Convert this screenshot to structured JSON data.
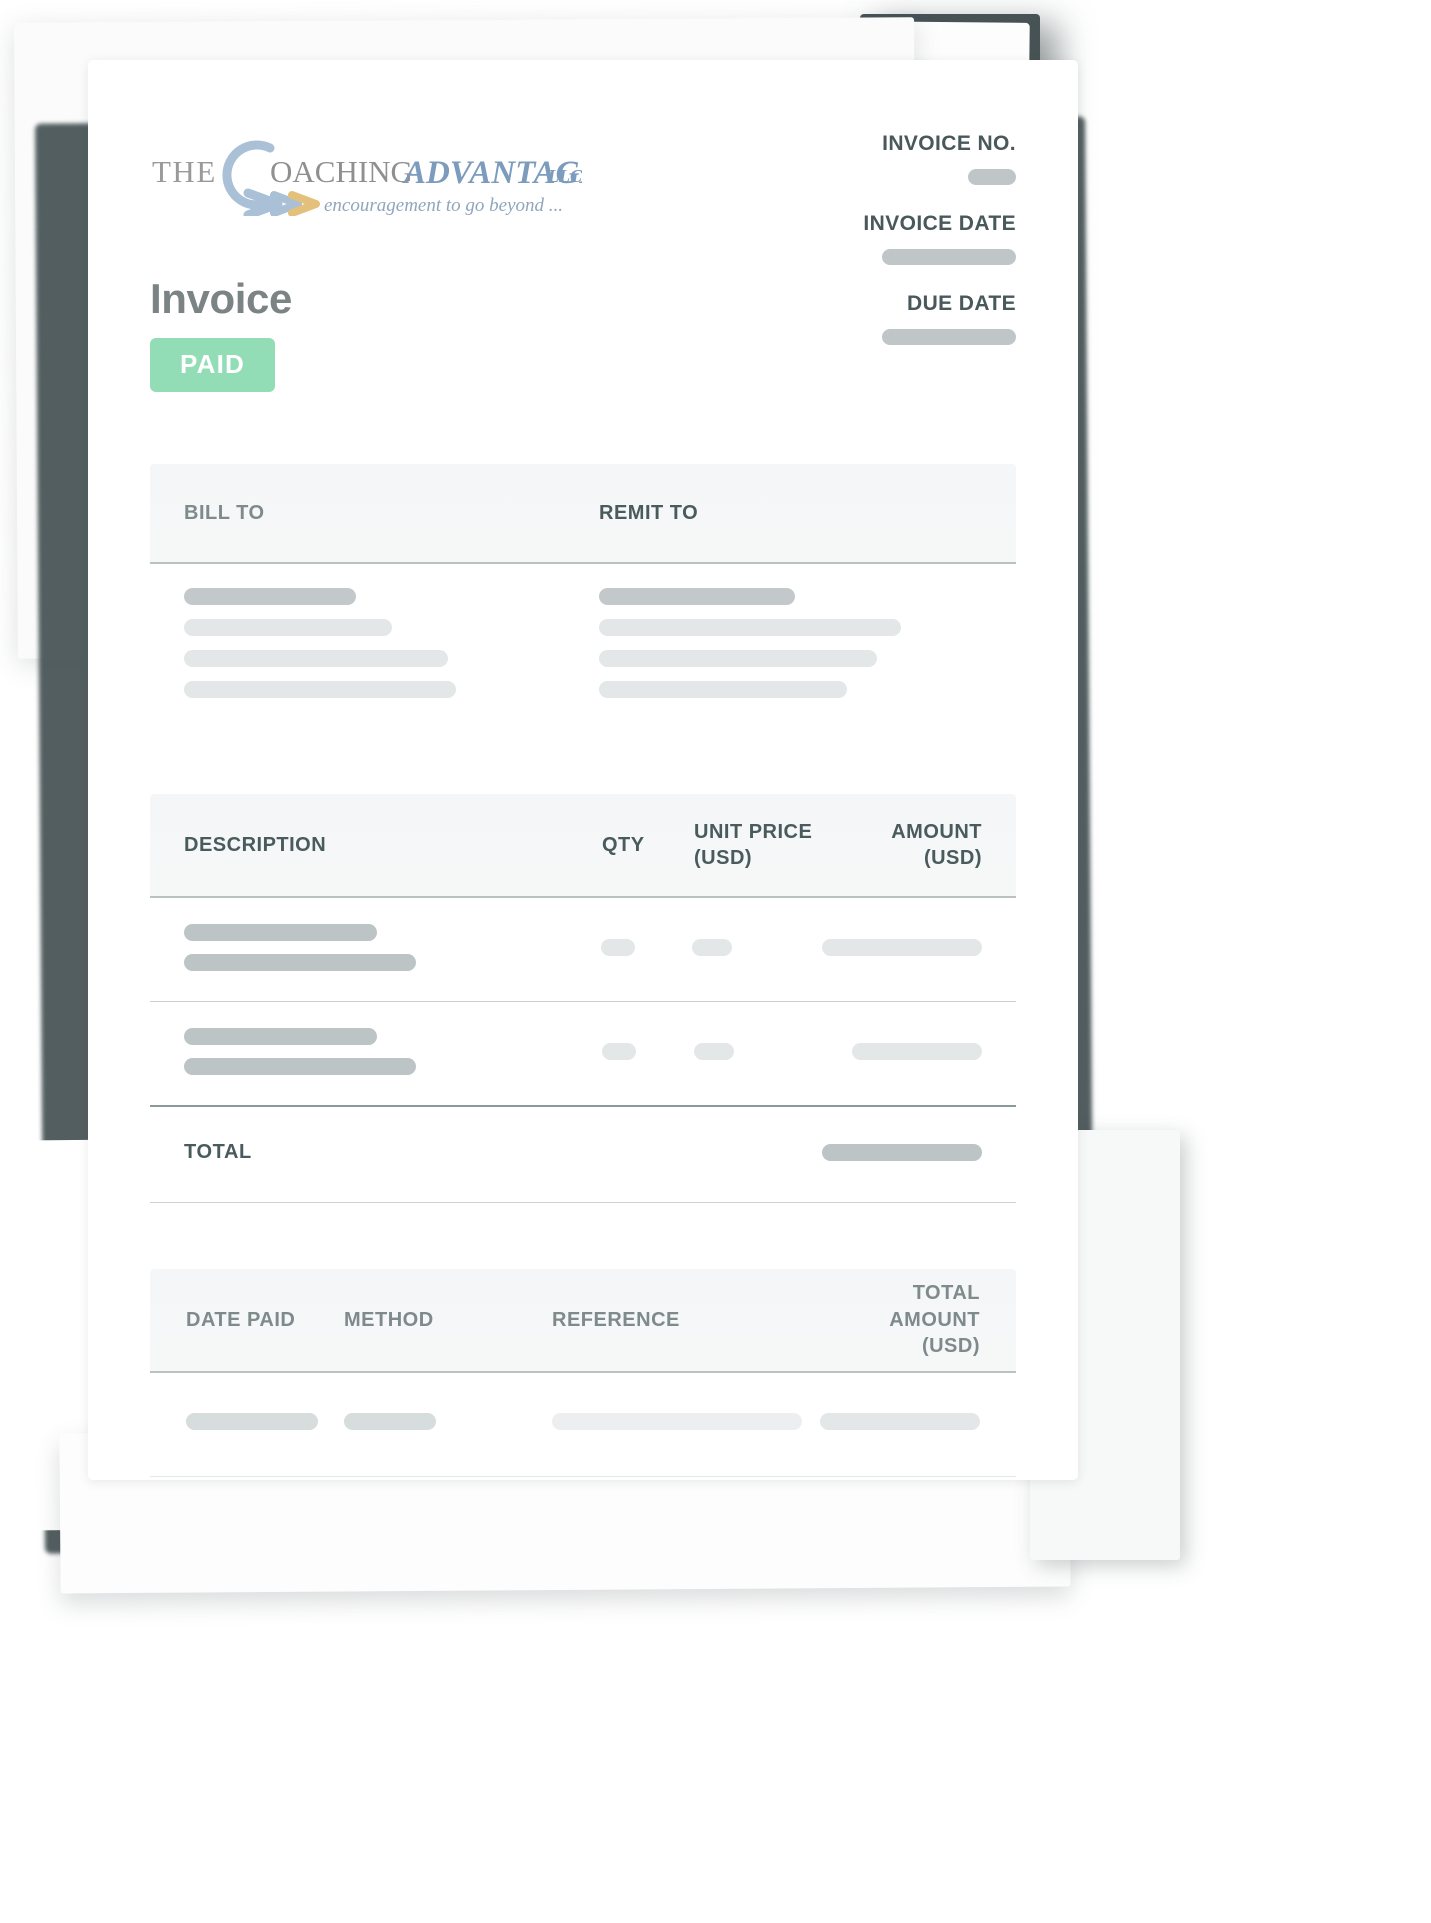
{
  "company": {
    "logo_the": "THE",
    "logo_coaching": "OACHING",
    "logo_advantage": "ADVANTAGE",
    "logo_llc": "LLC",
    "logo_c": "C",
    "tagline": "encouragement to go beyond ...",
    "logo_blue": "#9FB8D0",
    "logo_gray": "#9a9a9a",
    "logo_gold": "#E3C07B"
  },
  "header": {
    "invoice_no_label": "INVOICE NO.",
    "invoice_date_label": "INVOICE DATE",
    "due_date_label": "DUE DATE"
  },
  "title": {
    "heading": "Invoice",
    "status_badge": "PAID",
    "badge_color": "#93ddb6"
  },
  "parties": {
    "bill_to_label": "BILL TO",
    "remit_to_label": "REMIT TO"
  },
  "items_table": {
    "columns": {
      "description": "DESCRIPTION",
      "qty": "QTY",
      "unit_price": "UNIT PRICE",
      "unit_price_currency": "(USD)",
      "amount": "AMOUNT",
      "amount_currency": "(USD)"
    },
    "total_label": "TOTAL"
  },
  "payments_table": {
    "columns": {
      "date_paid": "DATE PAID",
      "method": "METHOD",
      "reference": "REFERENCE",
      "total_amount": "TOTAL AMOUNT",
      "total_amount_currency": "(USD)"
    }
  },
  "placeholders": {
    "note": "redacted content bars"
  }
}
